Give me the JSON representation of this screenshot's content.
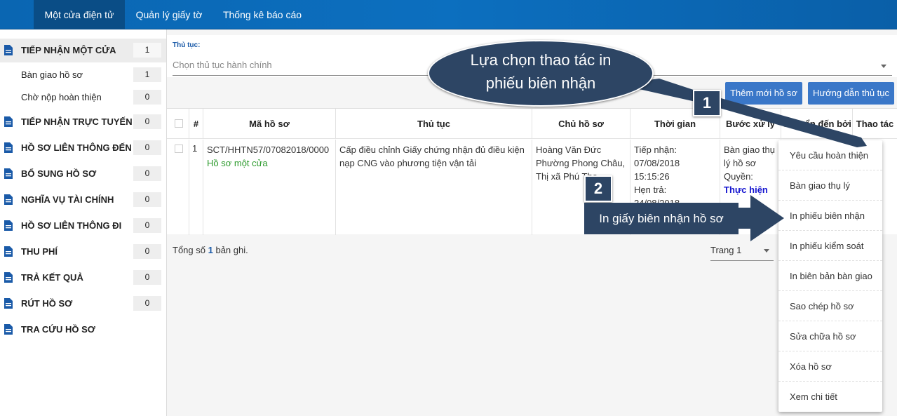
{
  "nav": {
    "tabs": [
      "Một cửa điện tử",
      "Quản lý giấy tờ",
      "Thống kê báo cáo"
    ]
  },
  "sidebar": {
    "items": [
      {
        "label": "TIẾP NHẬN MỘT CỬA",
        "count": "1"
      },
      {
        "label": "Bàn giao hồ sơ",
        "count": "1"
      },
      {
        "label": "Chờ nộp hoàn thiện",
        "count": "0"
      },
      {
        "label": "TIẾP NHẬN TRỰC TUYẾN",
        "count": "0"
      },
      {
        "label": "HỒ SƠ LIÊN THÔNG ĐẾN",
        "count": "0"
      },
      {
        "label": "BỔ SUNG HỒ SƠ",
        "count": "0"
      },
      {
        "label": "NGHĨA VỤ TÀI CHÍNH",
        "count": "0"
      },
      {
        "label": "HỒ SƠ LIÊN THÔNG ĐI",
        "count": "0"
      },
      {
        "label": "THU PHÍ",
        "count": "0"
      },
      {
        "label": "TRẢ KẾT QUẢ",
        "count": "0"
      },
      {
        "label": "RÚT HỒ SƠ",
        "count": "0"
      },
      {
        "label": "TRA CỨU HỒ SƠ",
        "count": ""
      }
    ]
  },
  "filter": {
    "label": "Thủ tục:",
    "placeholder": "Chọn thủ tục hành chính"
  },
  "buttons": {
    "add": "Thêm mới hồ sơ",
    "guide": "Hướng dẫn thủ tục"
  },
  "table": {
    "headers": [
      "#",
      "Mã hồ sơ",
      "Thủ tục",
      "Chủ hồ sơ",
      "Thời gian",
      "Bước xử lý",
      "Chuyển đến bởi",
      "Thao tác"
    ],
    "row": {
      "index": "1",
      "code": "SCT/HHTN57/07082018/0000",
      "code_status": "Hồ sơ một cửa",
      "procedure": "Cấp điều chỉnh Giấy chứng nhận đủ điều kiện nạp CNG vào phương tiện vận tải",
      "owner": "Hoàng Văn Đức Phường Phong Châu, Thị xã Phú Thọ",
      "time_received_label": "Tiếp nhận:",
      "time_received": "07/08/2018 15:15:26",
      "time_due_label": "Hẹn trả:",
      "time_due": "24/08/2018",
      "step": "Bàn giao thụ lý hồ sơ",
      "rights_label": "Quyền:",
      "rights_value": "Thực hiện"
    }
  },
  "footer": {
    "total_prefix": "Tổng số",
    "total_count": "1",
    "total_suffix": "bản ghi.",
    "page": "Trang 1"
  },
  "menu": {
    "items": [
      "Yêu cầu hoàn thiện",
      "Bàn giao thụ lý",
      "In phiếu biên nhận",
      "In phiếu kiểm soát",
      "In biên bản bàn giao",
      "Sao chép hồ sơ",
      "Sửa chữa hồ sơ",
      "Xóa hồ sơ",
      "Xem chi tiết"
    ]
  },
  "annotations": {
    "bubble_line1": "Lựa chọn thao tác in",
    "bubble_line2": "phiếu biên nhận",
    "step1": "1",
    "step2": "2",
    "callout": "In giấy biên nhận hồ sơ"
  },
  "colors": {
    "nav_bg": "#0c6fbf",
    "nav_active": "#0a4d86",
    "button": "#3a77c8",
    "annotation": "#2d4564",
    "status_green": "#2c9a2c"
  }
}
